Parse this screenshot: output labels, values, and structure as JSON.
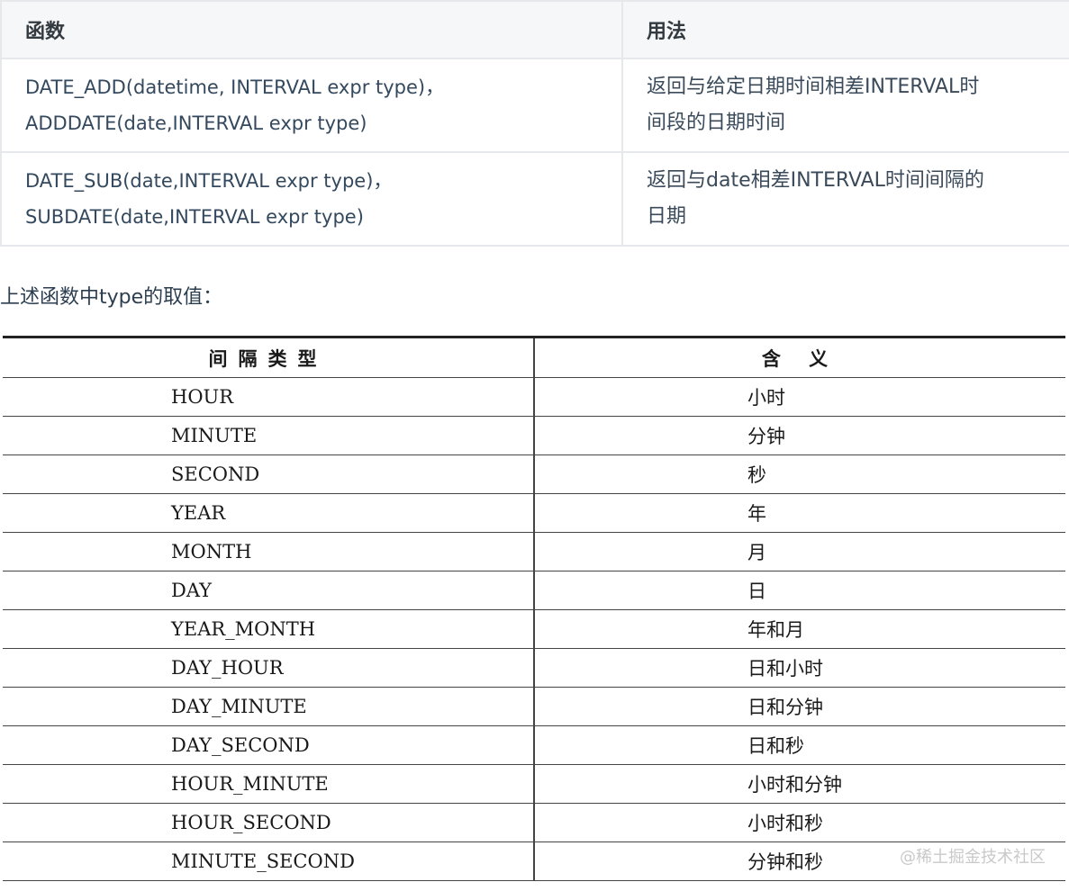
{
  "functions_table": {
    "headers": [
      "函数",
      "用法"
    ],
    "rows": [
      {
        "func_line1": "DATE_ADD(datetime, INTERVAL expr type)，",
        "func_line2": "ADDDATE(date,INTERVAL expr type)",
        "desc_line1": "返回与给定日期时间相差INTERVAL时",
        "desc_line2": "间段的日期时间"
      },
      {
        "func_line1": "DATE_SUB(date,INTERVAL expr type)，",
        "func_line2": "SUBDATE(date,INTERVAL expr type)",
        "desc_line1": "返回与date相差INTERVAL时间间隔的",
        "desc_line2": "日期"
      }
    ]
  },
  "intro_text": "上述函数中type的取值：",
  "types_table": {
    "headers": [
      "间隔类型",
      "含 义"
    ],
    "rows": [
      {
        "type": "HOUR",
        "meaning": "小时"
      },
      {
        "type": "MINUTE",
        "meaning": "分钟"
      },
      {
        "type": "SECOND",
        "meaning": "秒"
      },
      {
        "type": "YEAR",
        "meaning": "年"
      },
      {
        "type": "MONTH",
        "meaning": "月"
      },
      {
        "type": "DAY",
        "meaning": "日"
      },
      {
        "type": "YEAR_MONTH",
        "meaning": "年和月"
      },
      {
        "type": "DAY_HOUR",
        "meaning": "日和小时"
      },
      {
        "type": "DAY_MINUTE",
        "meaning": "日和分钟"
      },
      {
        "type": "DAY_SECOND",
        "meaning": "日和秒"
      },
      {
        "type": "HOUR_MINUTE",
        "meaning": "小时和分钟"
      },
      {
        "type": "HOUR_SECOND",
        "meaning": "小时和秒"
      },
      {
        "type": "MINUTE_SECOND",
        "meaning": "分钟和秒"
      }
    ]
  },
  "watermark": "@稀土掘金技术社区"
}
